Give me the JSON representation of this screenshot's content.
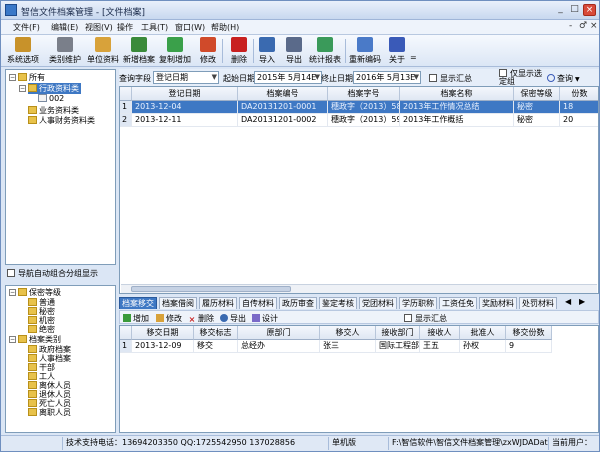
{
  "window": {
    "title": "智信文件档案管理 - [文件档案]",
    "controls": {
      "minimize": "_",
      "maximize": "□",
      "close": "×"
    }
  },
  "menu": {
    "items": [
      "文件(F)",
      "编辑(E)",
      "视图(V)",
      "操作",
      "工具(T)",
      "窗口(W)",
      "帮助(H)"
    ],
    "mdi": {
      "minimize": "-",
      "restore": "♂",
      "close": "×"
    }
  },
  "toolbar": {
    "items": [
      {
        "label": "系统选项",
        "icon": "system-options-icon",
        "color": "#c8922a"
      },
      {
        "label": "类别维护",
        "icon": "category-tools-icon",
        "color": "#7a7f8a"
      },
      {
        "label": "单位资料",
        "icon": "unit-info-icon",
        "color": "#d8a23a"
      },
      {
        "label": "新增档案",
        "icon": "new-file-icon",
        "color": "#3a8a3a"
      },
      {
        "label": "复制增加",
        "icon": "copy-add-icon",
        "color": "#3aa04a"
      },
      {
        "label": "修改",
        "icon": "edit-pencil-icon",
        "color": "#d04a2a"
      },
      {
        "label": "删除",
        "icon": "delete-x-icon",
        "color": "#c82020"
      },
      {
        "label": "导入",
        "icon": "import-icon",
        "color": "#3a6ab0"
      },
      {
        "label": "导出",
        "icon": "export-printer-icon",
        "color": "#5a6a8a"
      },
      {
        "label": "统计报表",
        "icon": "report-chart-icon",
        "color": "#3a9a5a"
      },
      {
        "label": "重新编码",
        "icon": "recode-icon",
        "color": "#4a7ac8"
      },
      {
        "label": "关于",
        "icon": "about-question-icon",
        "color": "#3a5ab8"
      }
    ],
    "more": "="
  },
  "tree_top": {
    "root": "所有",
    "nodes": [
      "行政资料类",
      "002",
      "业务资料类",
      "人事财务资料类"
    ]
  },
  "auto_group": {
    "label": "导航自动组合分组显示"
  },
  "tree_bottom": {
    "group1": "保密等级",
    "group1_items": [
      "普通",
      "秘密",
      "机密",
      "绝密"
    ],
    "group2": "档案类别",
    "group2_items": [
      "政府档案",
      "人事档案",
      "干部",
      "工人",
      "离休人员",
      "退休人员",
      "死亡人员",
      "离职人员"
    ]
  },
  "filter": {
    "query_field_label": "查询字段",
    "query_field_value": "登记日期",
    "start_label": "起始日期",
    "start_value": "2015年 5月14E",
    "end_label": "终止日期",
    "end_value": "2016年 5月13E",
    "summary_label": "显示汇总",
    "only_selected_label": "仅显示选定组",
    "query_button": "查询"
  },
  "main_table": {
    "columns": [
      "登记日期",
      "档案编号",
      "档案字号",
      "档案名称",
      "保密等级",
      "份数"
    ],
    "rows": [
      {
        "n": "1",
        "date": "2013-12-04",
        "no": "DA20131201-0001",
        "ref": "穗政字（2013）58号",
        "name": "2013年工作情况总结",
        "level": "秘密",
        "count": "18"
      },
      {
        "n": "2",
        "date": "2013-12-11",
        "no": "DA20131201-0002",
        "ref": "穗政字（2013）59号",
        "name": "2013年工作概括",
        "level": "秘密",
        "count": "20"
      }
    ]
  },
  "tabs": {
    "items": [
      "档案移交",
      "档案借阅",
      "履历材料",
      "自传材料",
      "政历审查",
      "鉴定考核",
      "党团材料",
      "学历职称",
      "工资任免",
      "奖励材料",
      "处罚材料"
    ],
    "nav_prev": "◀",
    "nav_next": "▶"
  },
  "subtoolbar": {
    "add": "增加",
    "edit": "修改",
    "delete": "删除",
    "export": "导出",
    "design": "设计",
    "summary_label": "显示汇总"
  },
  "sub_table": {
    "columns": [
      "移交日期",
      "移交标志",
      "原部门",
      "移交人",
      "接收部门",
      "接收人",
      "批准人",
      "移交份数"
    ],
    "rows": [
      {
        "n": "1",
        "date": "2013-12-09",
        "flag": "移交",
        "from": "总经办",
        "by": "张三",
        "to": "国际工程部",
        "recv": "王五",
        "approver": "孙权",
        "count": "9"
      }
    ]
  },
  "status": {
    "support": "技术支持电话：13694203350 QQ:1725542950 137028856",
    "edition": "单机版",
    "path": "F:\\智信软件\\智信文件档案管理\\zxWJDAData.sys",
    "user": "当前用户："
  }
}
